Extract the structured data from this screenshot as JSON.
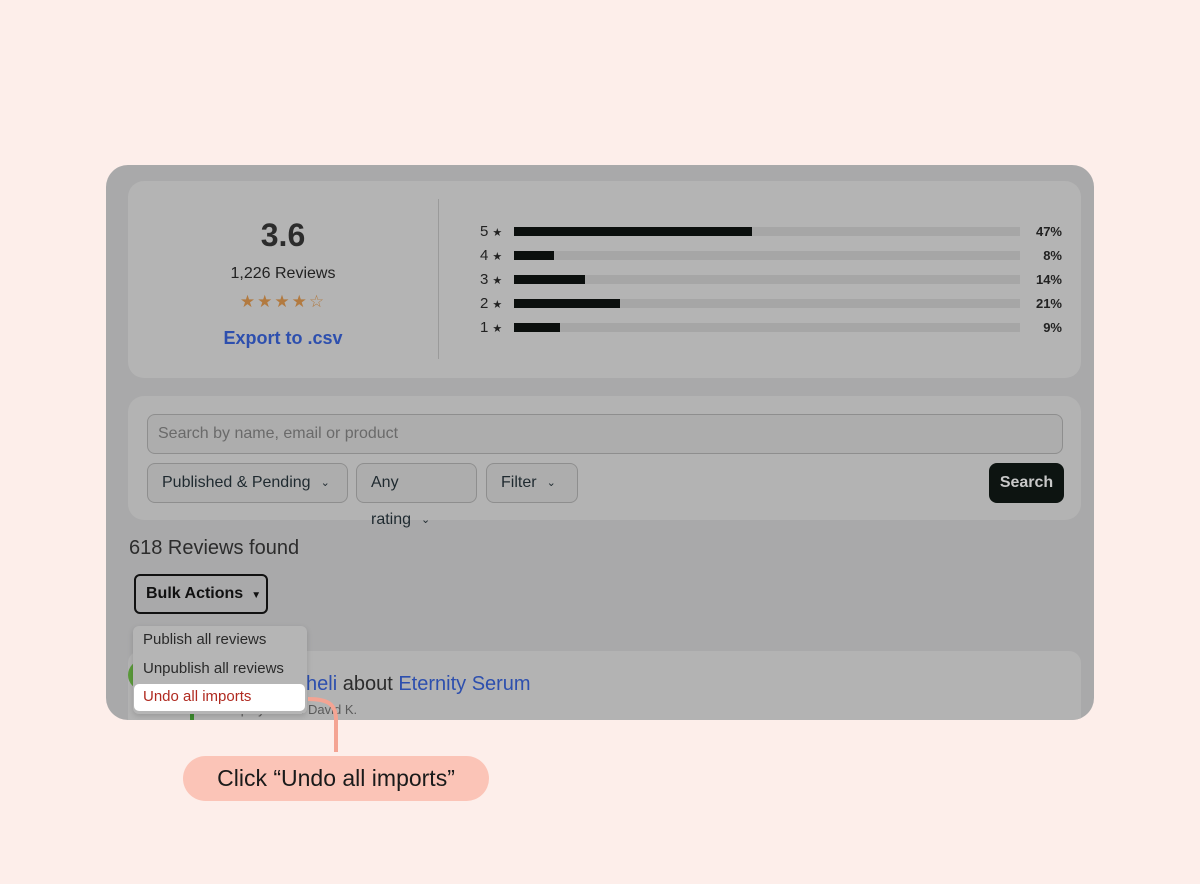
{
  "summary": {
    "average": "3.6",
    "review_count": "1,226 Reviews",
    "stars": "★★★★☆",
    "export_label": "Export to .csv",
    "distribution": [
      {
        "stars": "5",
        "percent_label": "47%",
        "fraction": 0.47
      },
      {
        "stars": "4",
        "percent_label": "8%",
        "fraction": 0.08
      },
      {
        "stars": "3",
        "percent_label": "14%",
        "fraction": 0.14
      },
      {
        "stars": "2",
        "percent_label": "21%",
        "fraction": 0.21
      },
      {
        "stars": "1",
        "percent_label": "9%",
        "fraction": 0.09
      }
    ]
  },
  "filters": {
    "search_placeholder": "Search by name, email or product",
    "status_select": "Published & Pending",
    "rating_select": "Any rating",
    "filter_select": "Filter",
    "search_button": "Search"
  },
  "results": {
    "found_text": "618 Reviews found",
    "bulk_actions_label": "Bulk Actions"
  },
  "bulk_menu": {
    "items": [
      "Publish all reviews",
      "Unpublish all reviews",
      "Undo all imports"
    ]
  },
  "review": {
    "name_fragment": "heli",
    "about_text": "about",
    "product": "Eternity Serum",
    "display_name": "Display name: David K."
  },
  "callout": {
    "text": "Click “Undo all imports”"
  },
  "colors": {
    "link": "#2d4fae",
    "danger": "#b02a20",
    "bar_fill": "#0b0f0d",
    "star": "#b27a40",
    "callout_bg": "#fbc4b7",
    "callout_line": "#f4a493"
  }
}
